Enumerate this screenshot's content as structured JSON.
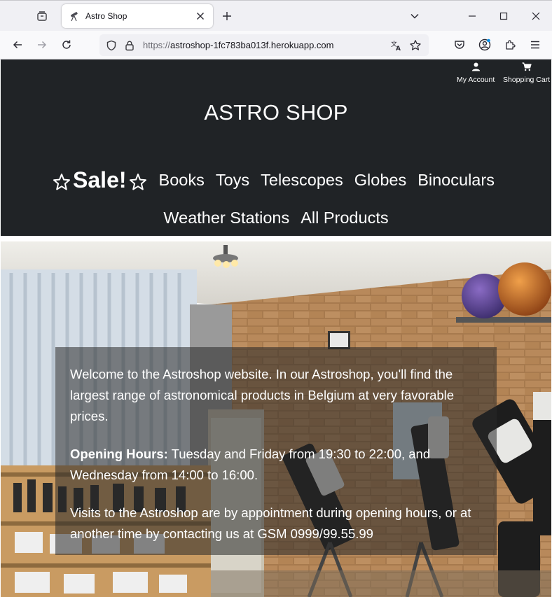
{
  "browser": {
    "tab": {
      "title": "Astro Shop"
    },
    "url": {
      "scheme": "https://",
      "host_path": "astroshop-1fc783ba013f.herokuapp.com"
    }
  },
  "header": {
    "my_account_label": "My Account",
    "shopping_cart_label": "Shopping Cart",
    "site_title": "ASTRO SHOP"
  },
  "nav": {
    "sale_label": "Sale!",
    "row1": [
      "Books",
      "Toys",
      "Telescopes",
      "Globes",
      "Binoculars"
    ],
    "row2": [
      "Weather Stations",
      "All Products"
    ]
  },
  "hero": {
    "welcome_text": "Welcome to the Astroshop website. In our Astroshop, you'll find the largest range of astronomical products in Belgium at very favorable prices.",
    "hours_label": "Opening Hours:",
    "hours_text": " Tuesday and Friday from 19:30 to 22:00, and Wednesday from 14:00 to 16:00.",
    "visits_text": "Visits to the Astroshop are by appointment during opening hours, or at another time by contacting us at GSM 0999/99.55.99"
  },
  "colors": {
    "header_bg": "#202326",
    "header_text": "#ffffff",
    "browser_tabbar": "#f0f0f4",
    "overlay": "rgba(40,40,40,0.55)"
  },
  "icons": [
    "tab-list-icon",
    "telescope-favicon-icon",
    "close-icon",
    "plus-icon",
    "chevron-down-icon",
    "minimize-icon",
    "maximize-icon",
    "window-close-icon",
    "back-arrow-icon",
    "forward-arrow-icon",
    "reload-icon",
    "shield-icon",
    "lock-icon",
    "translate-icon",
    "bookmark-star-icon",
    "pocket-icon",
    "account-icon",
    "extensions-icon",
    "menu-icon",
    "user-icon",
    "cart-icon",
    "star-icon"
  ]
}
